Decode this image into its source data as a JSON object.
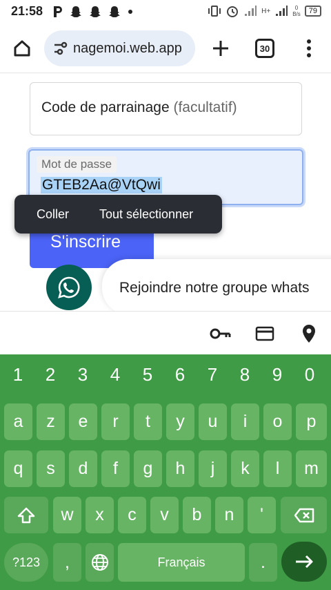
{
  "status_bar": {
    "time": "21:58",
    "network_type": "H+",
    "data_speed": "0",
    "data_unit": "B/s",
    "battery": "79"
  },
  "browser": {
    "url": "nagemoi.web.app",
    "tab_count": "30"
  },
  "form": {
    "referral_label": "Code de parrainage",
    "referral_optional": "(facultatif)",
    "password_label": "Mot de passe",
    "password_value": "GTEB2Aa@VtQwi",
    "signup_button": "S'inscrire",
    "whatsapp_text": "Rejoindre notre groupe whats"
  },
  "context_menu": {
    "paste": "Coller",
    "select_all": "Tout sélectionner"
  },
  "keyboard": {
    "numbers": [
      "1",
      "2",
      "3",
      "4",
      "5",
      "6",
      "7",
      "8",
      "9",
      "0"
    ],
    "row1": [
      "a",
      "z",
      "e",
      "r",
      "t",
      "y",
      "u",
      "i",
      "o",
      "p"
    ],
    "row2": [
      "q",
      "s",
      "d",
      "f",
      "g",
      "h",
      "j",
      "k",
      "l",
      "m"
    ],
    "row3": [
      "w",
      "x",
      "c",
      "v",
      "b",
      "n",
      "'"
    ],
    "symbols_key": "?123",
    "comma": ",",
    "space_label": "Français",
    "period": "."
  },
  "colors": {
    "keyboard_bg": "#3f9b45",
    "signup_button": "#4b63f7",
    "whatsapp": "#075e54"
  }
}
